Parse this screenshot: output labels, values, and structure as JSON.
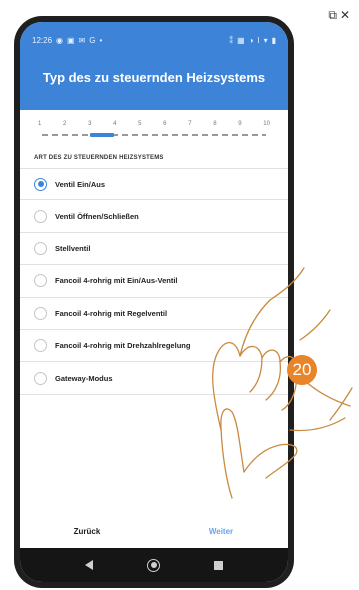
{
  "status_bar": {
    "time": "12:26",
    "left_icons": [
      "circle-icon",
      "photo-icon",
      "mail-icon",
      "g-icon",
      "dot-icon"
    ],
    "right_icons": [
      "vibrate-icon",
      "nfc-icon",
      "circle-icon",
      "signal-icon",
      "wifi-icon",
      "battery-icon"
    ]
  },
  "header": {
    "title": "Typ des zu steuernden Heizsystems"
  },
  "stepper": {
    "steps": [
      "1",
      "2",
      "3",
      "4",
      "5",
      "6",
      "7",
      "8",
      "9",
      "10"
    ],
    "active_step": 3
  },
  "section_label": "ART DES ZU STEUERNDEN HEIZSYSTEMS",
  "options": [
    {
      "label": "Ventil Ein/Aus",
      "selected": true
    },
    {
      "label": "Ventil Öffnen/Schließen",
      "selected": false
    },
    {
      "label": "Stellventil",
      "selected": false
    },
    {
      "label": "Fancoil 4-rohrig mit Ein/Aus-Ventil",
      "selected": false
    },
    {
      "label": "Fancoil 4-rohrig mit Regelventil",
      "selected": false
    },
    {
      "label": "Fancoil 4-rohrig mit Drehzahlregelung",
      "selected": false
    },
    {
      "label": "Gateway-Modus",
      "selected": false
    }
  ],
  "footer": {
    "back_label": "Zurück",
    "next_label": "Weiter"
  },
  "navbar": {
    "icons": [
      "back-triangle-icon",
      "home-circle-icon",
      "recent-apps-icon"
    ]
  },
  "step_badge": "20",
  "corner_icons": [
    "external-link-icon",
    "close-icon"
  ],
  "colors": {
    "header": "#3d84d8",
    "accent": "#3d84d8",
    "next_button": "#6da4e6",
    "badge": "#e8842a",
    "navbar": "#151515"
  }
}
